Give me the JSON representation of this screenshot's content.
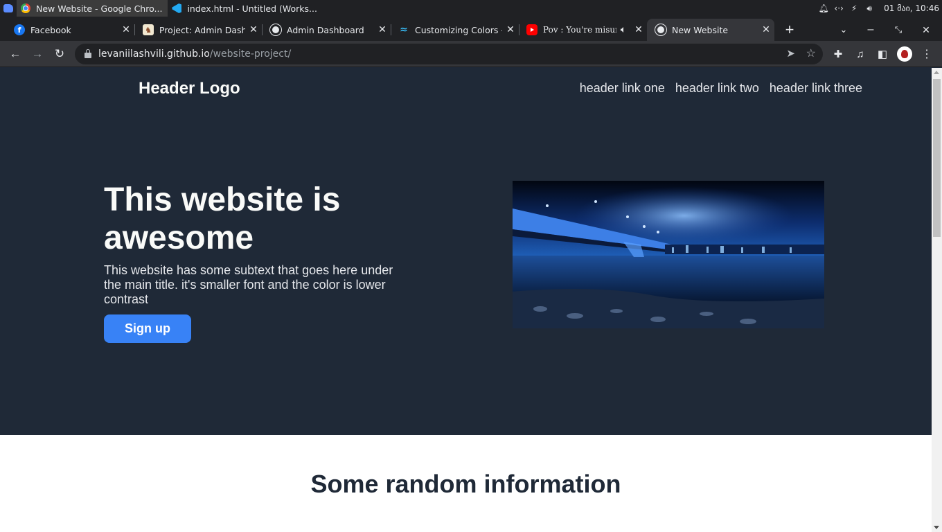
{
  "os": {
    "tasks": [
      {
        "label": "New Website - Google Chro..."
      },
      {
        "label": "index.html - Untitled (Works..."
      }
    ],
    "clock": "01 მაი, 10:46"
  },
  "browser": {
    "tabs": [
      {
        "label": "Facebook"
      },
      {
        "label": "Project: Admin Dashb"
      },
      {
        "label": "Admin Dashboard"
      },
      {
        "label": "Customizing Colors - T"
      },
      {
        "label": "Pov : You're misun"
      },
      {
        "label": "New Website"
      }
    ],
    "url_host": "levaniilashvili.github.io",
    "url_path": "/website-project/"
  },
  "page": {
    "header": {
      "logo": "Header Logo",
      "links": [
        "header link one",
        "header link two",
        "header link three"
      ]
    },
    "hero": {
      "title": "This website is awesome",
      "subtext": "This website has some subtext that goes here under the main title. it's smaller font and the color is lower contrast",
      "cta": "Sign up"
    },
    "info": {
      "title": "Some random information"
    }
  },
  "colors": {
    "hero_bg": "#1f2937",
    "accent": "#3882f6",
    "light_text": "#f9faf8",
    "muted_text": "#e5e7eb"
  }
}
